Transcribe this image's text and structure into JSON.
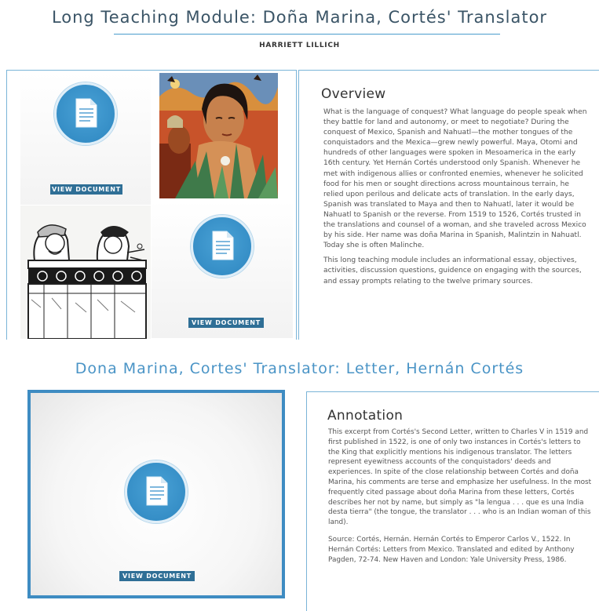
{
  "header": {
    "title": "Long Teaching Module: Doña Marina, Cortés' Translator",
    "author": "HARRIETT LILLICH"
  },
  "gallery": {
    "view_document_label": "VIEW DOCUMENT",
    "icons": [
      "document-icon",
      "document-icon"
    ],
    "images": [
      "painting-image",
      "codex-image"
    ]
  },
  "overview": {
    "heading": "Overview",
    "paragraph1": "What is the language of conquest? What language do people speak when they battle for land and autonomy, or meet to negotiate? During the conquest of Mexico, Spanish and Nahuatl—the mother tongues of the conquistadors and the Mexica—grew newly powerful. Maya, Otomi and hundreds of other languages were spoken in Mesoamerica in the early 16th century. Yet Hernán Cortés understood only Spanish. Whenever he met with indigenous allies or confronted enemies, whenever he solicited food for his men or sought directions across mountainous terrain, he relied upon perilous and delicate acts of translation. In the early days, Spanish was translated to Maya and then to Nahuatl, later it would be Nahuatl to Spanish or the reverse. From 1519 to 1526, Cortés trusted in the translations and counsel of a woman, and she traveled across Mexico by his side. Her name was doña Marina in Spanish, Malintzin in Nahuatl. Today she is often Malinche.",
    "paragraph2": "This long teaching module includes an informational essay, objectives, activities, discussion questions, guidence on engaging with the sources, and essay prompts relating to the twelve primary sources."
  },
  "section2": {
    "title": "Dona Marina, Cortes' Translator: Letter, Hernán Cortés",
    "view_document_label": "VIEW DOCUMENT"
  },
  "annotation": {
    "heading": "Annotation",
    "paragraph1": "This excerpt from Cortés's Second Letter, written to Charles V in 1519 and first published in 1522, is one of only two instances in Cortés's letters to the King that explicitly mentions his indigenous translator. The letters represent eyewitness accounts of the conquistadors' deeds and experiences. In spite of the close relationship between Cortés and doña Marina, his comments are terse and emphasize her usefulness. In the most frequently cited passage about doña Marina from these letters, Cortés describes her not by name, but simply as \"la lengua . . . que es una India desta tierra\" (the tongue, the translator . . . who is an Indian woman of this land).",
    "paragraph2": "Source: Cortés, Hernán. Hernán Cortés to Emperor Carlos V., 1522. In Hernán Cortés: Letters from Mexico. Translated and edited by Anthony Pagden, 72-74. New Haven and London: Yale University Press, 1986."
  },
  "colors": {
    "accent": "#4a9ccd",
    "button": "#2f6f96",
    "frame": "#3e8cc2"
  }
}
